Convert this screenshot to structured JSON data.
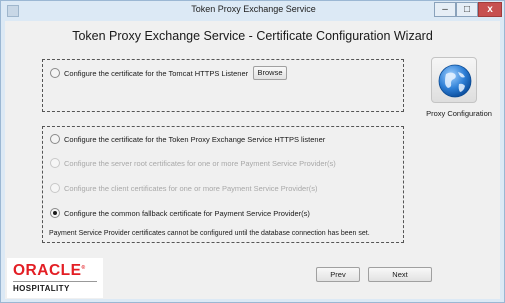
{
  "window": {
    "title": "Token Proxy Exchange Service",
    "controls": {
      "minimize": "–",
      "maximize": "□",
      "close": "x"
    }
  },
  "wizard": {
    "title": "Token Proxy Exchange Service - Certificate Configuration Wizard"
  },
  "tomcat_section": {
    "option_label": "Configure the certificate for the Tomcat HTTPS Listener",
    "selected": false,
    "browse_label": "Browse"
  },
  "proxy_section": {
    "options": [
      {
        "label": "Configure the certificate for the Token Proxy Exchange Service HTTPS listener",
        "selected": false,
        "enabled": true
      },
      {
        "label": "Configure the server root certificates for one or more Payment Service Provider(s)",
        "selected": false,
        "enabled": false
      },
      {
        "label": "Configure the client certificates for one or more Payment Service Provider(s)",
        "selected": false,
        "enabled": false
      },
      {
        "label": "Configure the common fallback certificate for Payment Service Provider(s)",
        "selected": true,
        "enabled": true
      }
    ],
    "info": "Payment Service Provider certificates cannot be configured until the database connection has been set."
  },
  "proxy_config": {
    "label": "Proxy Configuration",
    "icon": "globe-icon"
  },
  "navigation": {
    "prev_label": "Prev",
    "next_label": "Next"
  },
  "branding": {
    "brand": "ORACLE",
    "registered": "®",
    "product": "HOSPITALITY",
    "brand_color": "#e31e24"
  },
  "colors": {
    "title_bar": "#dce9f5",
    "close_button": "#c75050",
    "client_bg": "#f0f0f0"
  }
}
